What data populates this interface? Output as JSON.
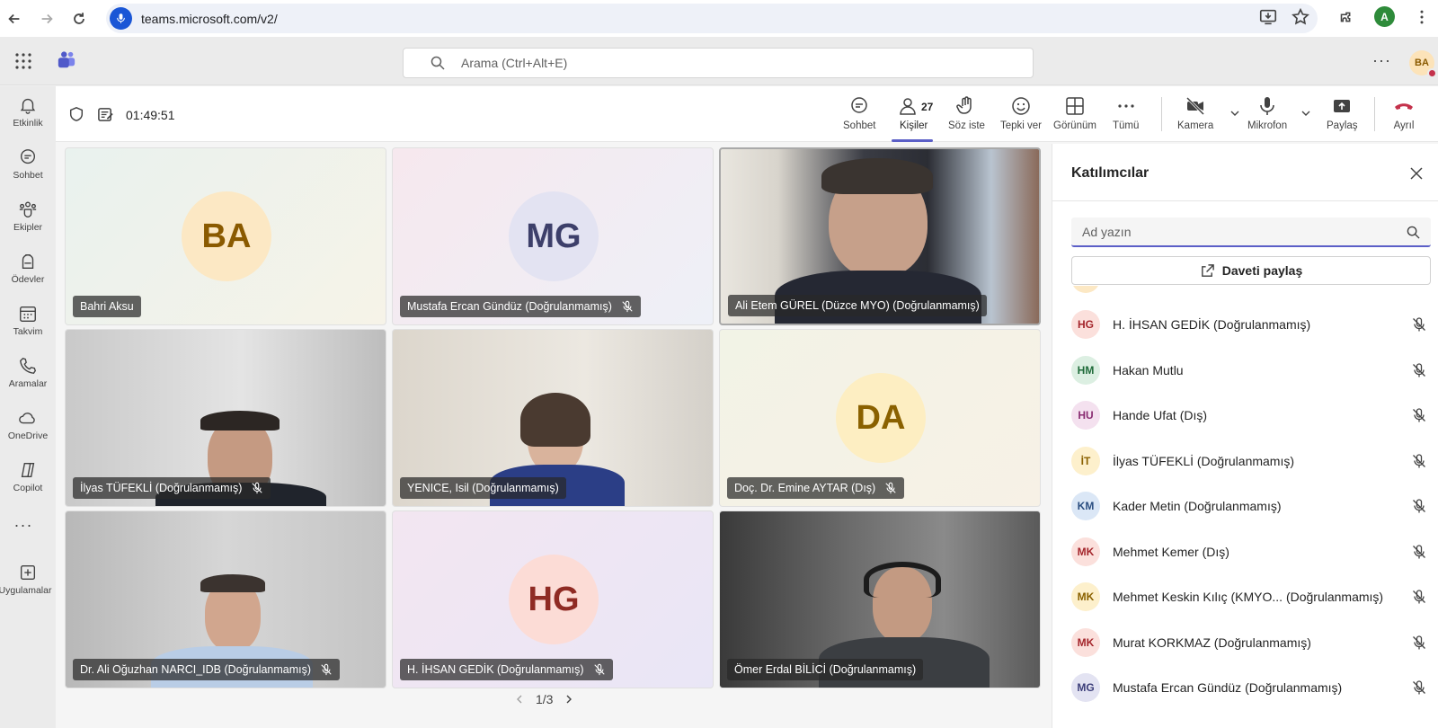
{
  "browser": {
    "url": "teams.microsoft.com/v2/",
    "profile_initial": "A"
  },
  "header": {
    "search_placeholder": "Arama (Ctrl+Alt+E)",
    "more": "···",
    "avatar_initials": "BA"
  },
  "rail": [
    {
      "label": "Etkinlik",
      "icon": "bell-icon"
    },
    {
      "label": "Sohbet",
      "icon": "chat-icon"
    },
    {
      "label": "Ekipler",
      "icon": "teams-icon"
    },
    {
      "label": "Ödevler",
      "icon": "backpack-icon"
    },
    {
      "label": "Takvim",
      "icon": "calendar-icon"
    },
    {
      "label": "Aramalar",
      "icon": "phone-icon"
    },
    {
      "label": "OneDrive",
      "icon": "cloud-icon"
    },
    {
      "label": "Copilot",
      "icon": "copilot-icon"
    },
    {
      "label": "Uygulamalar",
      "icon": "add-apps-icon"
    }
  ],
  "rail_more": "···",
  "meeting": {
    "timer": "01:49:51",
    "controls": {
      "chat": "Sohbet",
      "people": "Kişiler",
      "people_count": "27",
      "raise_hand": "Söz iste",
      "react": "Tepki ver",
      "view": "Görünüm",
      "more": "Tümü",
      "camera": "Kamera",
      "mic": "Mikrofon",
      "share": "Paylaş",
      "leave": "Ayrıl"
    },
    "pager": "1/3",
    "tiles": [
      {
        "name": "Bahri Aksu",
        "initials": "BA",
        "muted": false
      },
      {
        "name": "Mustafa Ercan Gündüz (Doğrulanmamış)",
        "initials": "MG",
        "muted": true
      },
      {
        "name": "Ali Etem GÜREL (Düzce MYO) (Doğrulanmamış)",
        "muted": false
      },
      {
        "name": "İlyas TÜFEKLİ (Doğrulanmamış)",
        "muted": true
      },
      {
        "name": "YENICE, Isil (Doğrulanmamış)",
        "muted": false
      },
      {
        "name": "Doç. Dr. Emine AYTAR (Dış)",
        "initials": "DA",
        "muted": true
      },
      {
        "name": "Dr. Ali Oğuzhan NARCI_IDB (Doğrulanmamış)",
        "muted": true
      },
      {
        "name": "H. İHSAN GEDİK (Doğrulanmamış)",
        "initials": "HG",
        "muted": true
      },
      {
        "name": "Ömer Erdal BİLİCİ (Doğrulanmamış)",
        "muted": false
      }
    ]
  },
  "panel": {
    "title": "Katılımcılar",
    "search_placeholder": "Ad yazın",
    "share_invite": "Daveti paylaş",
    "participants": [
      {
        "initials": "HG",
        "name": "H. İHSAN GEDİK (Doğrulanmamış)",
        "color": "#fbe0dc",
        "text": "#a4262c"
      },
      {
        "initials": "HM",
        "name": "Hakan Mutlu",
        "color": "#dcefe2",
        "text": "#1f6b3a"
      },
      {
        "initials": "HU",
        "name": "Hande Ufat (Dış)",
        "color": "#f4e1ef",
        "text": "#8a2d72"
      },
      {
        "initials": "İT",
        "name": "İlyas TÜFEKLİ (Doğrulanmamış)",
        "color": "#fdf0cc",
        "text": "#8a6100"
      },
      {
        "initials": "KM",
        "name": "Kader Metin (Doğrulanmamış)",
        "color": "#dbe7f6",
        "text": "#2b4e80"
      },
      {
        "initials": "MK",
        "name": "Mehmet Kemer (Dış)",
        "color": "#fbe0dc",
        "text": "#a4262c"
      },
      {
        "initials": "MK",
        "name": "Mehmet Keskin Kılıç (KMYO... (Doğrulanmamış)",
        "color": "#fdf0cc",
        "text": "#8a6100"
      },
      {
        "initials": "MK",
        "name": "Murat KORKMAZ (Doğrulanmamış)",
        "color": "#fbe0dc",
        "text": "#a4262c"
      },
      {
        "initials": "MG",
        "name": "Mustafa Ercan Gündüz (Doğrulanmamış)",
        "color": "#e3e3f2",
        "text": "#3d3f7a"
      }
    ]
  }
}
